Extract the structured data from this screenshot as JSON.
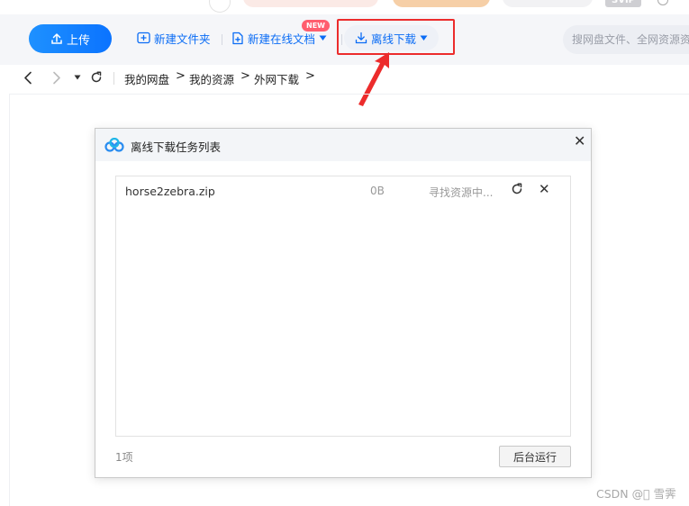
{
  "topbar": {
    "svip_badge": "SVIP"
  },
  "toolbar": {
    "upload_label": "上传",
    "new_folder_label": "新建文件夹",
    "new_online_doc_label": "新建在线文档",
    "new_badge": "NEW",
    "offline_download_label": "离线下载",
    "search_placeholder": "搜网盘文件、全网资源资",
    "accent_color": "#0a6cf5",
    "highlight_color": "#ec2c2c"
  },
  "breadcrumb": {
    "items": [
      "我的网盘",
      "我的资源",
      "外网下载"
    ]
  },
  "dialog": {
    "title": "离线下载任务列表",
    "tasks": [
      {
        "name": "horse2zebra.zip",
        "size": "0B",
        "status": "寻找资源中..."
      }
    ],
    "count_label": "1项",
    "background_run_label": "后台运行"
  },
  "watermark": "CSDN @\u0000 雪霁"
}
